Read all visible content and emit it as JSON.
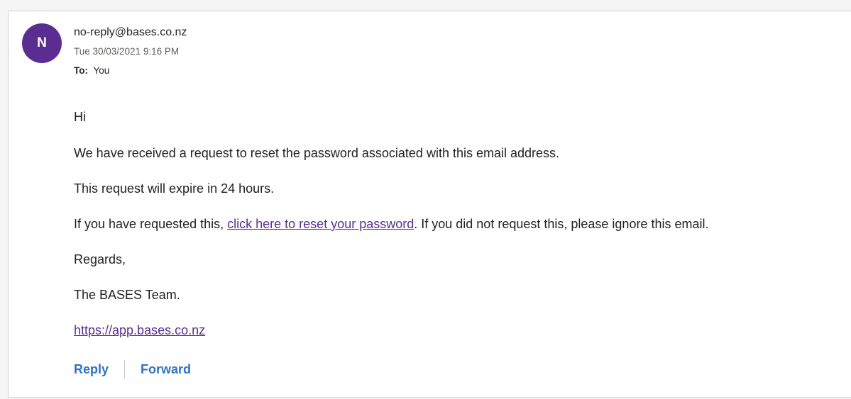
{
  "message": {
    "avatar_initial": "N",
    "avatar_color": "#5c2d91",
    "from": "no-reply@bases.co.nz",
    "date": "Tue 30/03/2021 9:16 PM",
    "to_label": "To:",
    "to_value": "You"
  },
  "body": {
    "greeting": "Hi",
    "line1": "We have received a request to reset the password associated with this email address.",
    "line2": "This request will expire in 24 hours.",
    "line3_prefix": "If you have requested this, ",
    "line3_link": "click here to reset your password",
    "line3_suffix": ". If you did not request this, please ignore this email.",
    "regards": "Regards,",
    "signature": "The BASES Team.",
    "site_link": "https://app.bases.co.nz"
  },
  "actions": {
    "reply_label": "Reply",
    "forward_label": "Forward"
  },
  "colors": {
    "link": "#5c2d91",
    "action": "#2f72c4"
  }
}
